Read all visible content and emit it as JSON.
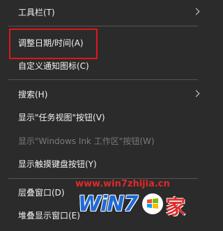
{
  "menu": {
    "toolbars": "工具栏(T)",
    "adjust_datetime": "调整日期/时间(A)",
    "customize_icons": "自定义通知图标(C)",
    "search": "搜索(H)",
    "show_task_view": "显示\"任务视图\"按钮(V)",
    "show_ink_workspace": "显示\"Windows Ink 工作区\"按钮(W)",
    "show_touch_keyboard": "显示触摸键盘按钮(Y)",
    "cascade_windows": "层叠窗口(D)",
    "stack_windows": "堆叠显示窗口(E)"
  },
  "watermark": {
    "url": "www.win7zhijia.cn",
    "logo_text": "WiN7",
    "logo_char": "家"
  },
  "colors": {
    "background": "#2b2b2b",
    "text": "#f2f2f2",
    "disabled_text": "#7a7a7a",
    "highlight_border": "#e0151b",
    "logo_blue": "#1e6ad6",
    "watermark_red": "#e02a2a"
  },
  "icons": {
    "submenu": "chevron-right-icon",
    "logo_flag": "windows-flag-icon"
  }
}
